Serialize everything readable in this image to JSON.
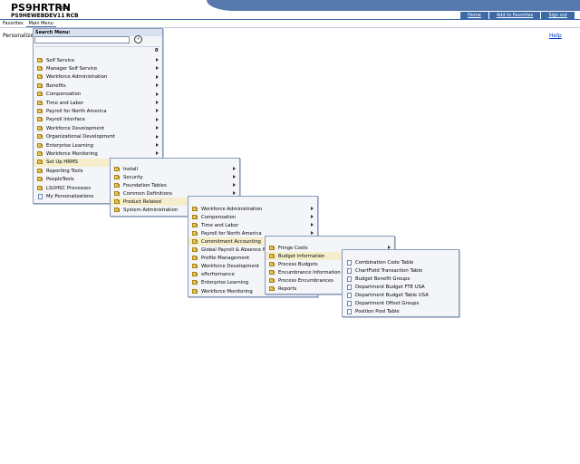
{
  "header": {
    "title": "PS9HRTRN",
    "version": "8.50",
    "database": "PS9HEWEBDEV11",
    "node": "RCB",
    "links": [
      "Home",
      "Add to Favorites",
      "Sign out"
    ]
  },
  "menubar": {
    "items": [
      "Favorites",
      "Main Menu"
    ]
  },
  "page": {
    "personalize": "Personalize",
    "help": "Help"
  },
  "search": {
    "title": "Search Menu:",
    "value": "",
    "placeholder": "",
    "count": "0"
  },
  "menus": {
    "main": [
      "Self Service",
      "Manager Self Service",
      "Workforce Administration",
      "Benefits",
      "Compensation",
      "Time and Labor",
      "Payroll for North America",
      "Payroll Interface",
      "Workforce Development",
      "Organizational Development",
      "Enterprise Learning",
      "Workforce Monitoring",
      "Set Up HRMS",
      "Reporting Tools",
      "PeopleTools",
      "LSUHSC Processes",
      "My Personalizations"
    ],
    "setup_hrms": [
      "Install",
      "Security",
      "Foundation Tables",
      "Common Definitions",
      "Product Related",
      "System Administration"
    ],
    "product_related": [
      "Workforce Administration",
      "Compensation",
      "Time and Labor",
      "Payroll for North America",
      "Commitment Accounting",
      "Global Payroll & Absence Mgmt",
      "Profile Management",
      "Workforce Development",
      "ePerformance",
      "Enterprise Learning",
      "Workforce Monitoring"
    ],
    "commitment_accounting": [
      "Fringe Costs",
      "Budget Information",
      "Process Budgets",
      "Encumbrance Information",
      "Process Encumbrances",
      "Reports"
    ],
    "budget_information": [
      "Combination Code Table",
      "ChartField Transaction Table",
      "Budget Benefit Groups",
      "Department Budget FTE USA",
      "Department Budget Table USA",
      "Department Offset Groups",
      "Position Pool Table"
    ]
  },
  "colors": {
    "header_blue": "#5879ad",
    "selected": "#f6eecb",
    "menu_bg": "#f3f5f9"
  }
}
